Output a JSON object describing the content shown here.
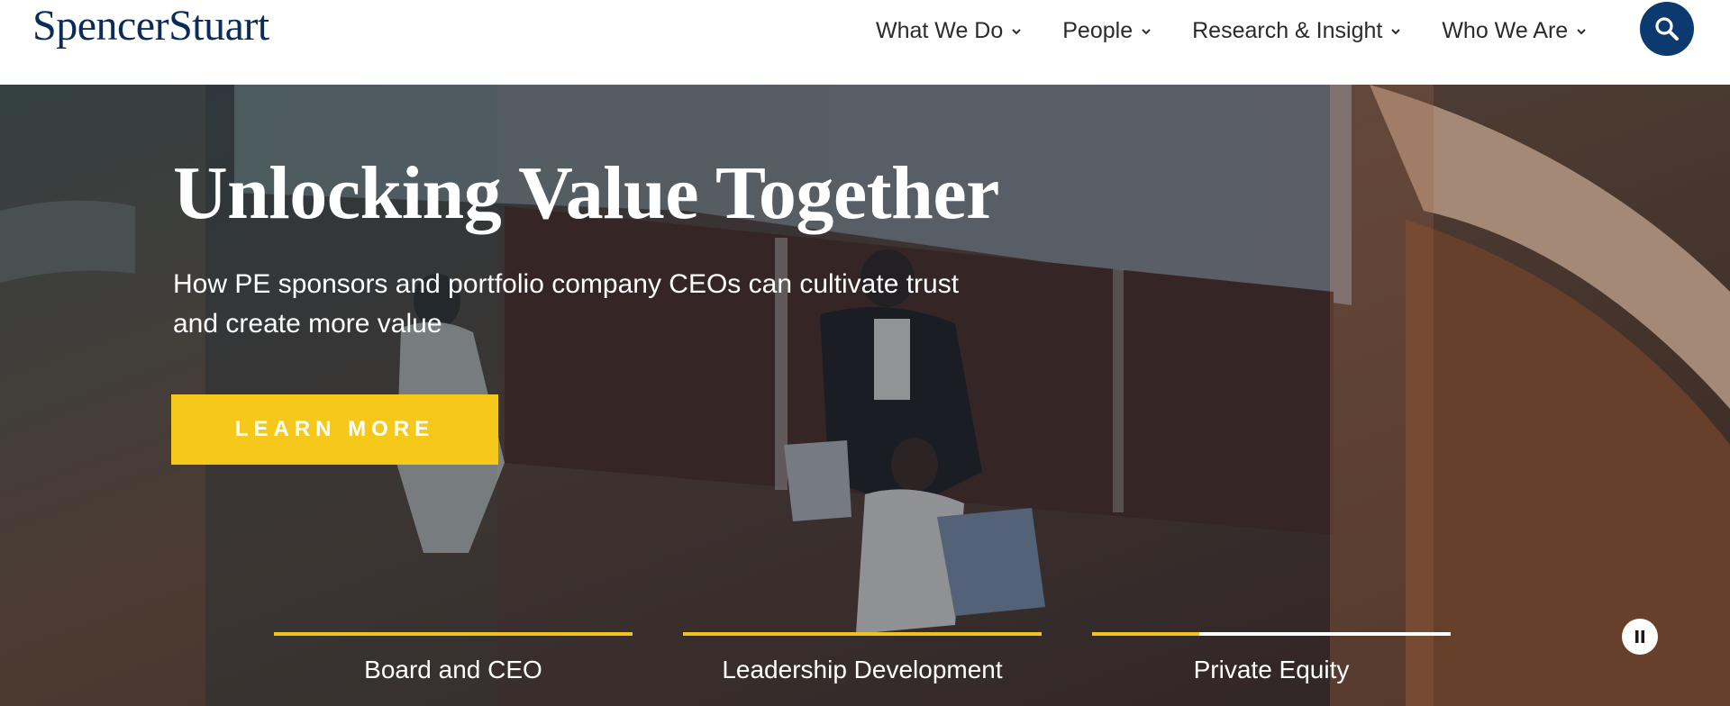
{
  "header": {
    "logo": "SpencerStuart",
    "nav": [
      {
        "label": "What We Do"
      },
      {
        "label": "People"
      },
      {
        "label": "Research & Insight"
      },
      {
        "label": "Who We Are"
      }
    ],
    "search_icon": "search-icon"
  },
  "hero": {
    "title": "Unlocking Value Together",
    "subtitle": "How PE sponsors and portfolio company CEOs can cultivate trust and create more value",
    "cta_label": "LEARN MORE",
    "tabs": [
      {
        "label": "Board and CEO",
        "progress": 1.0
      },
      {
        "label": "Leadership Development",
        "progress": 1.0
      },
      {
        "label": "Private Equity",
        "progress": 0.3
      }
    ],
    "pause_icon": "pause-icon"
  },
  "colors": {
    "brand_navy": "#0b2c5a",
    "search_bg": "#0c3a6e",
    "accent_yellow": "#f6c81a",
    "nav_text": "#2b2b2b"
  }
}
